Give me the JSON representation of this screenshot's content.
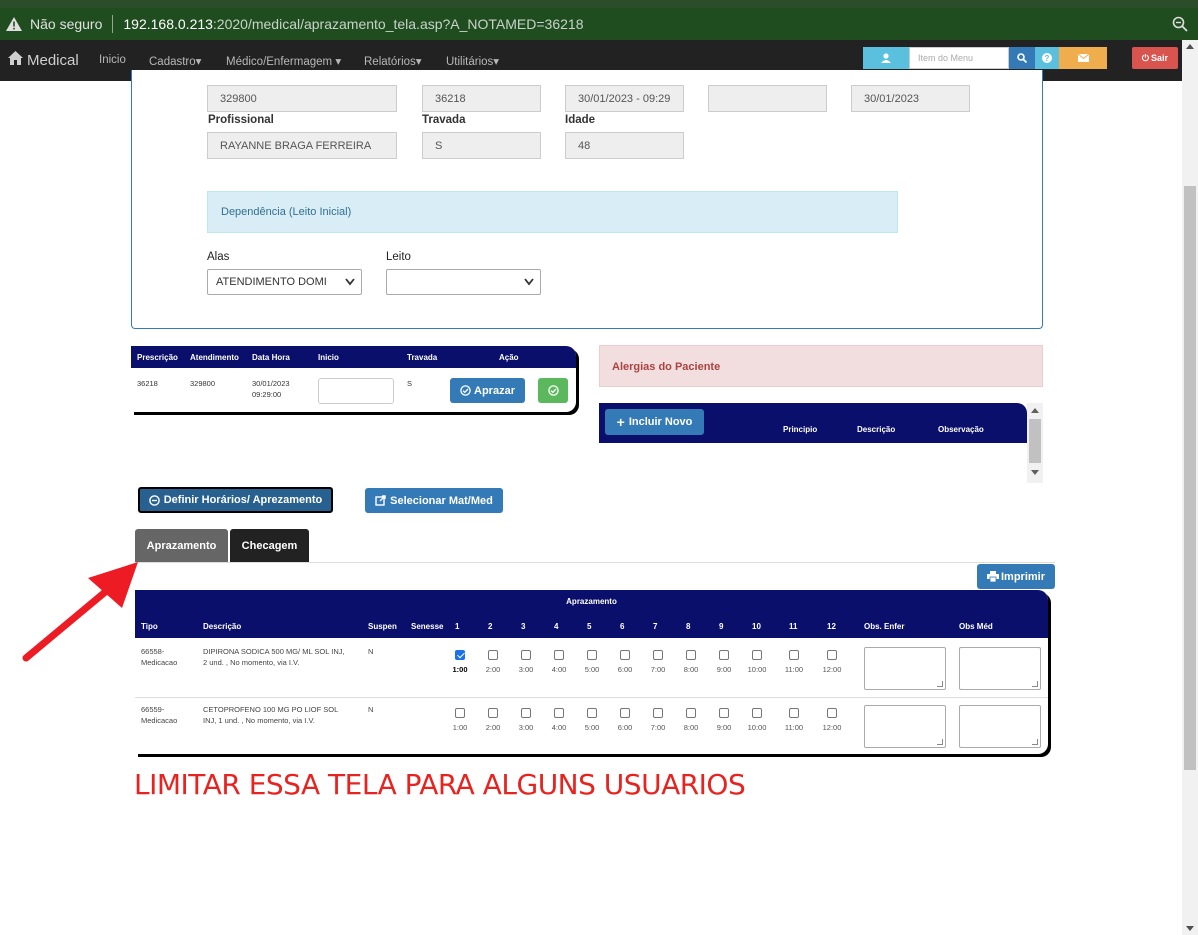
{
  "browser": {
    "security_label": "Não seguro",
    "url_host": "192.168.0.213",
    "url_rest": ":2020/medical/aprazamento_tela.asp?A_NOTAMED=36218"
  },
  "navbar": {
    "brand": "Medical",
    "items": [
      "Inicio",
      "Cadastro",
      "Médico/Enfermagem",
      "Relatórios",
      "Utilitários"
    ],
    "search_placeholder": "Item do Menu",
    "logout_label": "Sair"
  },
  "form": {
    "row1": [
      "329800",
      "36218",
      "30/01/2023 - 09:29",
      "",
      "30/01/2023"
    ],
    "labels": {
      "profissional": "Profissional",
      "travada": "Travada",
      "idade": "Idade",
      "alas": "Alas",
      "leito": "Leito"
    },
    "profissional": "RAYANNE BRAGA FERREIRA",
    "travada": "S",
    "idade": "48",
    "dependencia": "Dependência (Leito Inicial)",
    "alas_value": "ATENDIMENTO DOMI",
    "leito_value": ""
  },
  "prescription": {
    "headers": [
      "Prescrição",
      "Atendimento",
      "Data Hora",
      "Inicio",
      "Travada",
      "Ação"
    ],
    "row": {
      "prescricao": "36218",
      "atendimento": "329800",
      "data": "30/01/2023",
      "hora": "09:29:00",
      "travada": "S"
    },
    "aprazar_label": "Aprazar"
  },
  "allergies": {
    "title": "Alergias do Paciente",
    "add_label": "Incluir Novo",
    "columns": [
      "Principio",
      "Descrição",
      "Observação"
    ]
  },
  "actions": {
    "definir_label": "Definir Horários/ Aprezamento",
    "selecionar_label": "Selecionar Mat/Med",
    "imprimir_label": "Imprimir"
  },
  "tabs": [
    "Aprazamento",
    "Checagem"
  ],
  "aprazamento": {
    "title": "Aprazamento",
    "headers": [
      "Tipo",
      "Descrição",
      "Suspen",
      "Senesse",
      "1",
      "2",
      "3",
      "4",
      "5",
      "6",
      "7",
      "8",
      "9",
      "10",
      "11",
      "12",
      "Obs. Enfer",
      "Obs Méd"
    ],
    "hours": [
      "1:00",
      "2:00",
      "3:00",
      "4:00",
      "5:00",
      "6:00",
      "7:00",
      "8:00",
      "9:00",
      "10:00",
      "11:00",
      "12:00"
    ],
    "rows": [
      {
        "tipo1": "66558-",
        "tipo2": "Medicacao",
        "desc1": "DIPIRONA SODICA 500 MG/ ML SOL INJ,",
        "desc2": "2 und. , No momento, via I.V.",
        "suspen": "N",
        "checked": [
          true,
          false,
          false,
          false,
          false,
          false,
          false,
          false,
          false,
          false,
          false,
          false
        ]
      },
      {
        "tipo1": "66559-",
        "tipo2": "Medicacao",
        "desc1": "CETOPROFENO 100 MG PO LIOF SOL",
        "desc2": "INJ, 1 und. , No momento, via I.V.",
        "suspen": "N",
        "checked": [
          false,
          false,
          false,
          false,
          false,
          false,
          false,
          false,
          false,
          false,
          false,
          false
        ]
      }
    ]
  },
  "annotation": "LIMITAR ESSA TELA PARA ALGUNS USUARIOS",
  "colors": {
    "navy": "#0a0f6b",
    "primary": "#337ab7",
    "annotation": "#e8231f"
  }
}
